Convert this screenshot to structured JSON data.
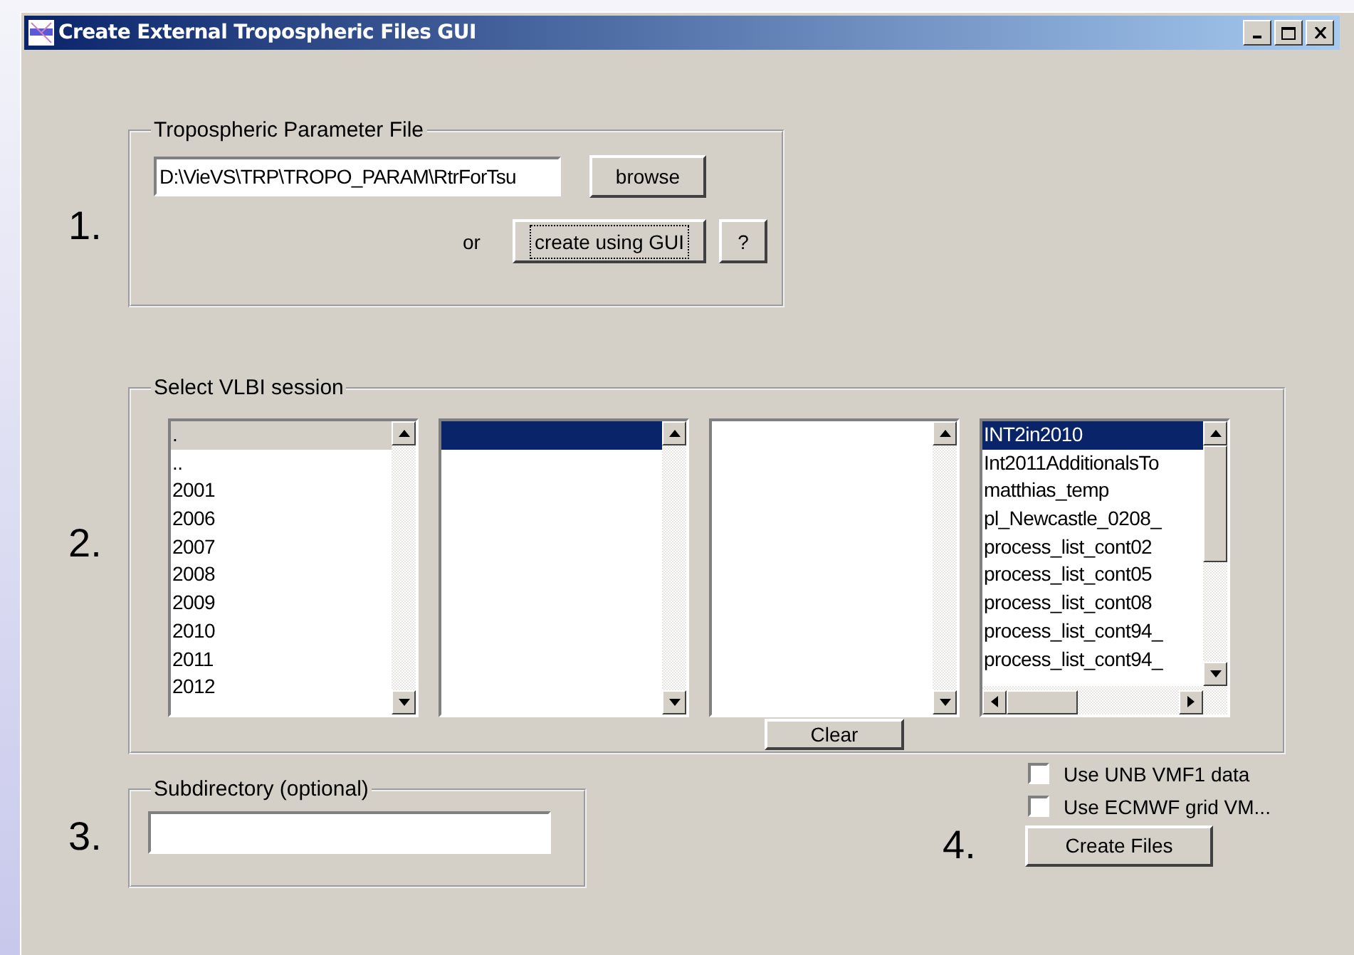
{
  "window": {
    "title": "Create External Tropospheric Files GUI"
  },
  "steps": [
    "1.",
    "2.",
    "3.",
    "4."
  ],
  "parameter_file": {
    "legend": "Tropospheric Parameter File",
    "path": "D:\\VieVS\\TRP\\TROPO_PARAM\\RtrForTsu",
    "browse_button": "browse",
    "or_label": "or",
    "create_button": "create using GUI",
    "help_button": "?"
  },
  "session": {
    "legend": "Select VLBI session",
    "lists": [
      {
        "kind": "plain",
        "focused": false,
        "items": [
          {
            "label": ".",
            "selected": true
          },
          {
            "label": "..",
            "selected": false
          },
          {
            "label": "2001",
            "selected": false
          },
          {
            "label": "2006",
            "selected": false
          },
          {
            "label": "2007",
            "selected": false
          },
          {
            "label": "2008",
            "selected": false
          },
          {
            "label": "2009",
            "selected": false
          },
          {
            "label": "2010",
            "selected": false
          },
          {
            "label": "2011",
            "selected": false
          },
          {
            "label": "2012",
            "selected": false
          }
        ]
      },
      {
        "kind": "plain",
        "focused": true,
        "items": [
          {
            "selected": true
          }
        ]
      },
      {
        "kind": "plain"
      },
      {
        "kind": "scrolled",
        "focused": true,
        "items": [
          {
            "label": "INT2in2010",
            "selected": true
          },
          {
            "label": "Int2011AdditionalsTo",
            "selected": false
          },
          {
            "label": "matthias_temp",
            "selected": false
          },
          {
            "label": "pl_Newcastle_0208_",
            "selected": false
          },
          {
            "label": "process_list_cont02",
            "selected": false
          },
          {
            "label": "process_list_cont05",
            "selected": false
          },
          {
            "label": "process_list_cont08",
            "selected": false
          },
          {
            "label": "process_list_cont94_",
            "selected": false
          },
          {
            "label": "process_list_cont94_",
            "selected": false
          }
        ]
      }
    ],
    "clear_button": "Clear"
  },
  "subdirectory": {
    "legend": "Subdirectory (optional)"
  },
  "options": [
    {
      "label": "Use UNB VMF1 data",
      "checked": false
    },
    {
      "label": "Use ECMWF grid VM...",
      "checked": false
    }
  ],
  "create_files_button": "Create Files"
}
